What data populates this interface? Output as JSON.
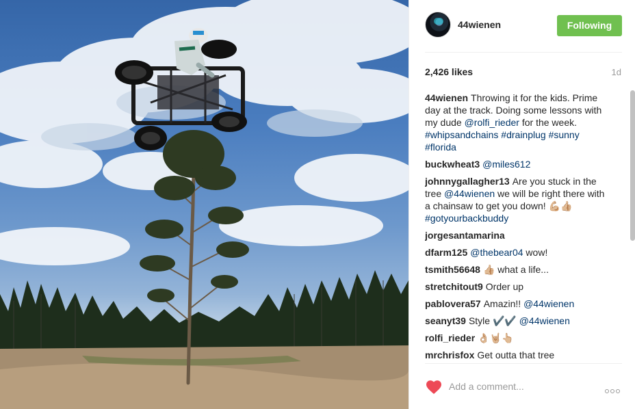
{
  "post": {
    "username": "44wienen",
    "follow_label": "Following",
    "likes": "2,426 likes",
    "age": "1d",
    "comment_placeholder": "Add a comment...",
    "accent_color": "#70c050",
    "like_color": "#ed4956"
  },
  "comments": [
    {
      "user": "44wienen",
      "parts": [
        {
          "t": "Throwing it for the kids. Prime day at the track. Doing some lessons with my dude "
        },
        {
          "t": "@rolfi_rieder",
          "link": true
        },
        {
          "t": " for the week. "
        },
        {
          "t": "#whipsandchains",
          "link": true
        },
        {
          "t": " "
        },
        {
          "t": "#drainplug",
          "link": true
        },
        {
          "t": " "
        },
        {
          "t": "#sunny",
          "link": true
        },
        {
          "t": " "
        },
        {
          "t": "#florida",
          "link": true
        }
      ]
    },
    {
      "user": "buckwheat3",
      "parts": [
        {
          "t": "@miles612",
          "link": true
        }
      ]
    },
    {
      "user": "johnnygallagher13",
      "parts": [
        {
          "t": "Are you stuck in the tree "
        },
        {
          "t": "@44wienen",
          "link": true
        },
        {
          "t": " we will be right there with a chainsaw to get you down! 💪🏼👍🏼 "
        },
        {
          "t": "#gotyourbackbuddy",
          "link": true
        }
      ]
    },
    {
      "user": "jorgesantamarina",
      "parts": []
    },
    {
      "user": "dfarm125",
      "parts": [
        {
          "t": "@thebear04",
          "link": true
        },
        {
          "t": " wow!"
        }
      ]
    },
    {
      "user": "tsmith56648",
      "parts": [
        {
          "t": "👍🏼 what a life..."
        }
      ]
    },
    {
      "user": "stretchitout9",
      "parts": [
        {
          "t": "Order up"
        }
      ]
    },
    {
      "user": "pablovera57",
      "parts": [
        {
          "t": "Amazin!! "
        },
        {
          "t": "@44wienen",
          "link": true
        }
      ]
    },
    {
      "user": "seanyt39",
      "parts": [
        {
          "t": "Style ✔️✔️ "
        },
        {
          "t": "@44wienen",
          "link": true
        }
      ]
    },
    {
      "user": "rolfi_rieder",
      "parts": [
        {
          "t": "👌🏼🤘🏼👆🏼"
        }
      ]
    },
    {
      "user": "mrchrisfox",
      "parts": [
        {
          "t": "Get outta that tree"
        }
      ]
    }
  ]
}
